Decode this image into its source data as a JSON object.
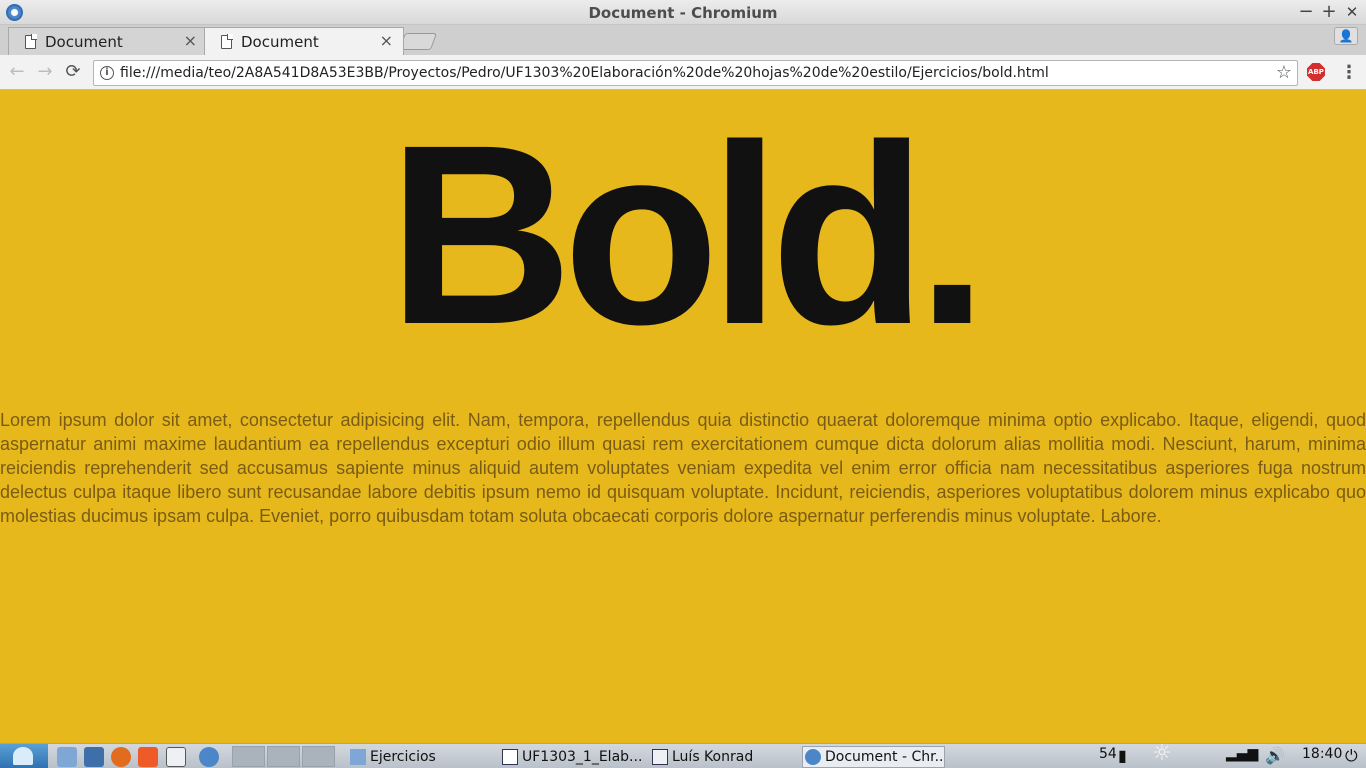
{
  "window": {
    "title": "Document - Chromium",
    "controls": [
      "−",
      "+",
      "✕"
    ]
  },
  "tabs": [
    {
      "label": "Document",
      "close": "×",
      "active": false
    },
    {
      "label": "Document",
      "close": "×",
      "active": true
    }
  ],
  "toolbar": {
    "url": "file:///media/teo/2A8A541D8A53E3BB/Proyectos/Pedro/UF1303%20Elaboración%20de%20hojas%20de%20estilo/Ejercicios/bold.html",
    "back_icon": "←",
    "forward_icon": "→",
    "reload_icon": "⟳",
    "star_icon": "☆",
    "abp_label": "ABP",
    "menu_icon": "⋮",
    "info_icon": "i"
  },
  "page": {
    "heading": "Bold.",
    "paragraph": "Lorem ipsum dolor sit amet, consectetur adipisicing elit. Nam, tempora, repellendus quia distinctio quaerat doloremque minima optio explicabo. Itaque, eligendi, quod aspernatur animi maxime laudantium ea repellendus excepturi odio illum quasi rem exercitationem cumque dicta dolorum alias mollitia modi. Nesciunt, harum, minima reiciendis reprehenderit sed accusamus sapiente minus aliquid autem voluptates veniam expedita vel enim error officia nam necessitatibus asperiores fuga nostrum delectus culpa itaque libero sunt recusandae labore debitis ipsum nemo id quisquam voluptate. Incidunt, reiciendis, asperiores voluptatibus dolorem minus explicabo quo molestias ducimus ipsam culpa. Eveniet, porro quibusdam totam soluta obcaecati corporis dolore aspernatur perferendis minus voluptate. Labore.",
    "background": "#e7b81b"
  },
  "taskbar": {
    "tasks": [
      {
        "label": "Ejercicios",
        "icon": "folder-icon"
      },
      {
        "label": "UF1303_1_Elab...",
        "icon": "document-icon"
      },
      {
        "label": "Luís Konrad",
        "icon": "window-icon"
      },
      {
        "label": "Document - Chr...",
        "icon": "chromium-icon"
      }
    ],
    "battery": "54",
    "clock": "18:40"
  }
}
